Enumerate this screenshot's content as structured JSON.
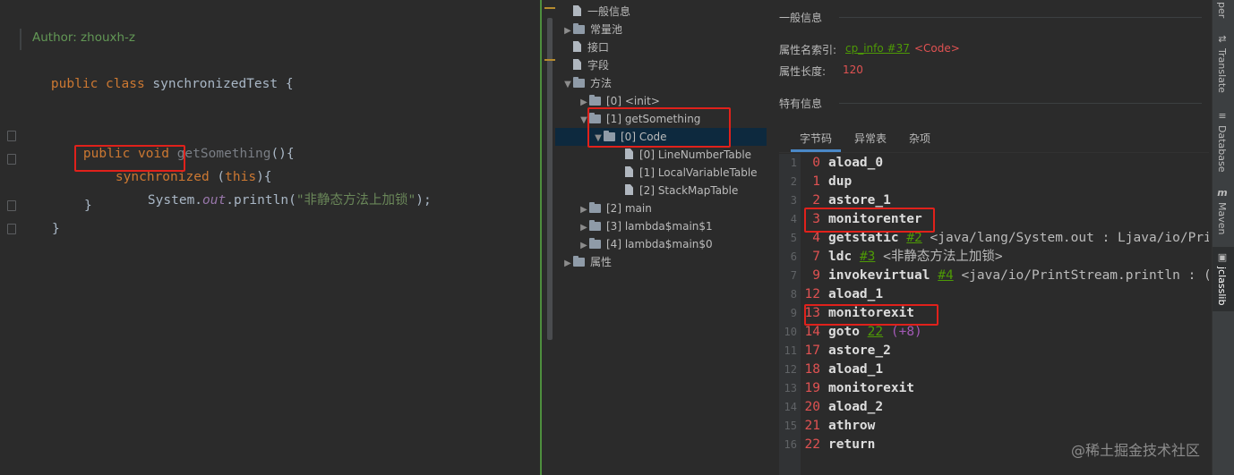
{
  "editor": {
    "author": "Author: zhouxh-z",
    "class_kw": "public class",
    "class_name": "synchronizedTest {",
    "method_kw": "public void",
    "method_name": "getSomething",
    "method_rest": "(){",
    "sync_kw": "synchronized",
    "sync_rest_1": "(",
    "sync_this": "this",
    "sync_rest_2": "){",
    "print_1": "System.",
    "print_field": "out",
    "print_2": ".println(",
    "print_str": "\"非静态方法上加锁\"",
    "print_3": ");",
    "close_inner": "}",
    "close_method": "}"
  },
  "tree": {
    "items": [
      {
        "label": "一般信息",
        "icon": "file-icon"
      },
      {
        "label": "常量池",
        "icon": "folder-icon"
      },
      {
        "label": "接口",
        "icon": "file-icon"
      },
      {
        "label": "字段",
        "icon": "file-icon"
      },
      {
        "label": "方法",
        "icon": "folder-icon"
      },
      {
        "label": "[0] <init>",
        "icon": "folder-icon"
      },
      {
        "label": "[1] getSomething",
        "icon": "folder-icon"
      },
      {
        "label": "[0] Code",
        "icon": "folder-icon"
      },
      {
        "label": "[0] LineNumberTable",
        "icon": "file-icon"
      },
      {
        "label": "[1] LocalVariableTable",
        "icon": "file-icon"
      },
      {
        "label": "[2] StackMapTable",
        "icon": "file-icon"
      },
      {
        "label": "[2] main",
        "icon": "folder-icon"
      },
      {
        "label": "[3] lambda$main$1",
        "icon": "folder-icon"
      },
      {
        "label": "[4] lambda$main$0",
        "icon": "folder-icon"
      },
      {
        "label": "属性",
        "icon": "folder-icon"
      }
    ]
  },
  "info": {
    "general_title": "一般信息",
    "name_index_label": "属性名索引:",
    "name_index_link": "cp_info #37",
    "name_index_value": "<Code>",
    "length_label": "属性长度:",
    "length_value": "120",
    "specific_title": "特有信息",
    "tabs": [
      "字节码",
      "异常表",
      "杂项"
    ]
  },
  "bytecode": [
    {
      "ln": "1",
      "off": "0",
      "op": "aload_0"
    },
    {
      "ln": "2",
      "off": "1",
      "op": "dup"
    },
    {
      "ln": "3",
      "off": "2",
      "op": "astore_1"
    },
    {
      "ln": "4",
      "off": "3",
      "op": "monitorenter"
    },
    {
      "ln": "5",
      "off": "4",
      "op": "getstatic",
      "ref": "#2",
      "cmt": "<java/lang/System.out : Ljava/io/PrintS"
    },
    {
      "ln": "6",
      "off": "7",
      "op": "ldc",
      "ref": "#3",
      "cmt": "<非静态方法上加锁>"
    },
    {
      "ln": "7",
      "off": "9",
      "op": "invokevirtual",
      "ref": "#4",
      "cmt": "<java/io/PrintStream.println : (Lj"
    },
    {
      "ln": "8",
      "off": "12",
      "op": "aload_1"
    },
    {
      "ln": "9",
      "off": "13",
      "op": "monitorexit"
    },
    {
      "ln": "10",
      "off": "14",
      "op": "goto",
      "jmp": "22",
      "rel": "(+8)"
    },
    {
      "ln": "11",
      "off": "17",
      "op": "astore_2"
    },
    {
      "ln": "12",
      "off": "18",
      "op": "aload_1"
    },
    {
      "ln": "13",
      "off": "19",
      "op": "monitorexit"
    },
    {
      "ln": "14",
      "off": "20",
      "op": "aload_2"
    },
    {
      "ln": "15",
      "off": "21",
      "op": "athrow"
    },
    {
      "ln": "16",
      "off": "22",
      "op": "return"
    }
  ],
  "strip": {
    "top_label": "per",
    "translate": "Translate",
    "database": "Database",
    "maven": "Maven",
    "jclasslib": "jclasslib"
  },
  "watermark": "@稀土掘金技术社区",
  "colors": {
    "highlight_box": "#e0211b",
    "selection": "#0d293e",
    "keyword": "#cc7832",
    "string": "#6a8759",
    "link": "#4e9a06",
    "offset": "#e05252"
  }
}
